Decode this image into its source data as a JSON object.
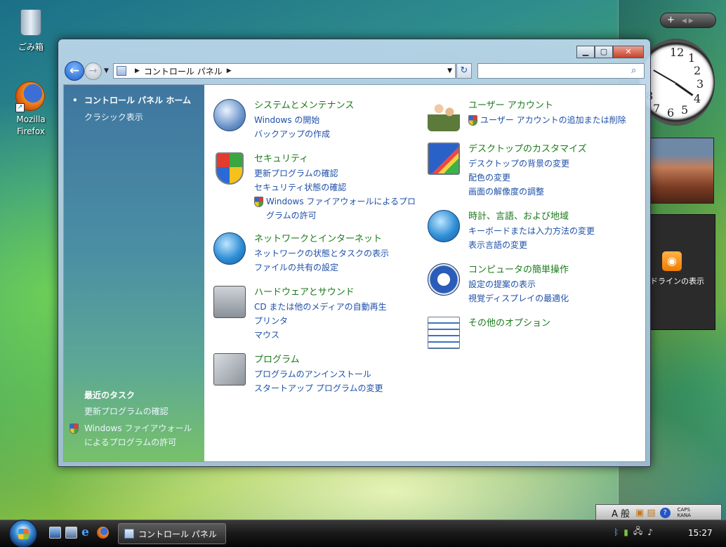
{
  "desktop": {
    "icons": [
      {
        "label": "ごみ箱"
      },
      {
        "label": "Mozilla Firefox"
      }
    ],
    "sidebar": {
      "feed_label": "ドラインの表示",
      "clock_numbers": [
        "12",
        "1",
        "2",
        "3",
        "4",
        "5",
        "6",
        "7",
        "8"
      ]
    }
  },
  "window": {
    "address": {
      "path": "コントロール パネル"
    },
    "search": {
      "placeholder": ""
    },
    "left_pane": {
      "home": "コントロール パネル ホーム",
      "classic": "クラシック表示",
      "recent_heading": "最近のタスク",
      "recent_tasks": [
        "更新プログラムの確認",
        "Windows ファイアウォールによるプログラムの許可"
      ]
    },
    "categories": {
      "system": {
        "title": "システムとメンテナンス",
        "links": [
          "Windows の開始",
          "バックアップの作成"
        ],
        "icon": "system-pie-icon"
      },
      "security": {
        "title": "セキュリティ",
        "links": [
          "更新プログラムの確認",
          "セキュリティ状態の確認",
          "Windows ファイアウォールによるプログラムの許可"
        ],
        "icon": "security-shield-icon"
      },
      "network": {
        "title": "ネットワークとインターネット",
        "links": [
          "ネットワークの状態とタスクの表示",
          "ファイルの共有の設定"
        ],
        "icon": "network-globe-icon"
      },
      "hardware": {
        "title": "ハードウェアとサウンド",
        "links": [
          "CD または他のメディアの自動再生",
          "プリンタ",
          "マウス"
        ],
        "icon": "printer-icon"
      },
      "programs": {
        "title": "プログラム",
        "links": [
          "プログラムのアンインストール",
          "スタートアップ プログラムの変更"
        ],
        "icon": "program-box-icon"
      },
      "users": {
        "title": "ユーザー アカウント",
        "links": [
          "ユーザー アカウントの追加または削除"
        ],
        "icon": "users-icon"
      },
      "desktop": {
        "title": "デスクトップのカスタマイズ",
        "links": [
          "デスクトップの背景の変更",
          "配色の変更",
          "画面の解像度の調整"
        ],
        "icon": "desktop-monitor-icon"
      },
      "clock": {
        "title": "時計、言語、および地域",
        "links": [
          "キーボードまたは入力方法の変更",
          "表示言語の変更"
        ],
        "icon": "clock-globe-icon"
      },
      "ease": {
        "title": "コンピュータの簡単操作",
        "links": [
          "設定の提案の表示",
          "視覚ディスプレイの最適化"
        ],
        "icon": "ease-of-access-icon"
      },
      "other": {
        "title": "その他のオプション",
        "links": [],
        "icon": "checklist-icon"
      }
    }
  },
  "taskbar": {
    "task_label": "コントロール パネル",
    "time": "15:27",
    "lang_text": "A 般",
    "caps": "CAPS",
    "kana": "KANA"
  }
}
